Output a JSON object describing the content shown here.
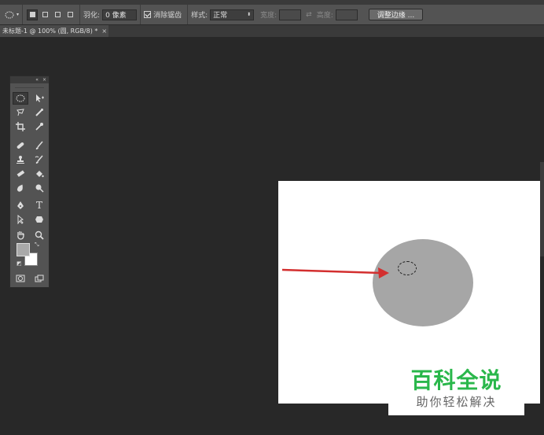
{
  "options_bar": {
    "feather_label": "羽化:",
    "feather_value": "0 像素",
    "antialias_label": "消除锯齿",
    "style_label": "样式:",
    "style_value": "正常",
    "width_label": "宽度:",
    "height_label": "高度:",
    "refine_edge_label": "调整边缘 ..."
  },
  "document_tab": {
    "title": "未标题-1 @ 100% (圆, RGB/8) *",
    "close_glyph": "×"
  },
  "toolbox": {
    "header_collapse": "«",
    "header_close": "×",
    "type_tool_glyph": "T"
  },
  "watermark": {
    "main": "百科全说",
    "sub": "助你轻松解决"
  },
  "colors": {
    "foreground": "#a9a9a9",
    "background": "#ffffff",
    "arrow": "#d32f2f",
    "watermark_green": "#2ab74b"
  }
}
